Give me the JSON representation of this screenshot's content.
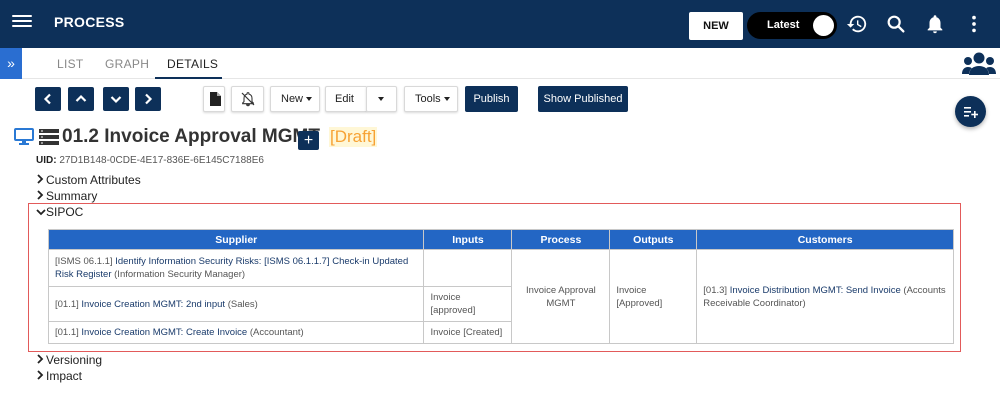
{
  "app": {
    "title": "PROCESS",
    "new_label": "NEW",
    "toggle_label": "Latest"
  },
  "tabs": [
    {
      "label": "LIST",
      "active": false
    },
    {
      "label": "GRAPH",
      "active": false
    },
    {
      "label": "DETAILS",
      "active": true
    }
  ],
  "toolbar": {
    "new_label": "New",
    "edit_label": "Edit",
    "tools_label": "Tools",
    "publish_label": "Publish",
    "show_published_label": "Show Published"
  },
  "page": {
    "title": "01.2 Invoice Approval MGMT",
    "status": "[Draft]",
    "uid_label": "UID:",
    "uid_value": "27D1B148-0CDE-4E17-836E-6E145C7188E6"
  },
  "sections": {
    "custom_attributes": "Custom Attributes",
    "summary": "Summary",
    "sipoc": "SIPOC",
    "versioning": "Versioning",
    "impact": "Impact"
  },
  "sipoc": {
    "headers": [
      "Supplier",
      "Inputs",
      "Process",
      "Outputs",
      "Customers"
    ],
    "suppliers": [
      {
        "prefix": "[ISMS 06.1.1]",
        "link": "Identify Information Security Risks: [ISMS 06.1.1.7] Check-in Updated Risk Register",
        "role": "(Information Security Manager)",
        "input": ""
      },
      {
        "prefix": "[01.1]",
        "link": "Invoice Creation MGMT: 2nd input",
        "role": "(Sales)",
        "input": "Invoice [approved]"
      },
      {
        "prefix": "[01.1]",
        "link": "Invoice Creation MGMT: Create Invoice",
        "role": "(Accountant)",
        "input": "Invoice [Created]"
      }
    ],
    "process": "Invoice Approval MGMT",
    "output": "Invoice [Approved]",
    "customer": {
      "prefix": "[01.3]",
      "link": "Invoice Distribution MGMT: Send Invoice",
      "role": "(Accounts Receivable Coordinator)"
    }
  },
  "colors": {
    "navy": "#0d3059",
    "table_header": "#2366c4",
    "draft": "#f7a234",
    "highlight_border": "#e25a5a"
  }
}
